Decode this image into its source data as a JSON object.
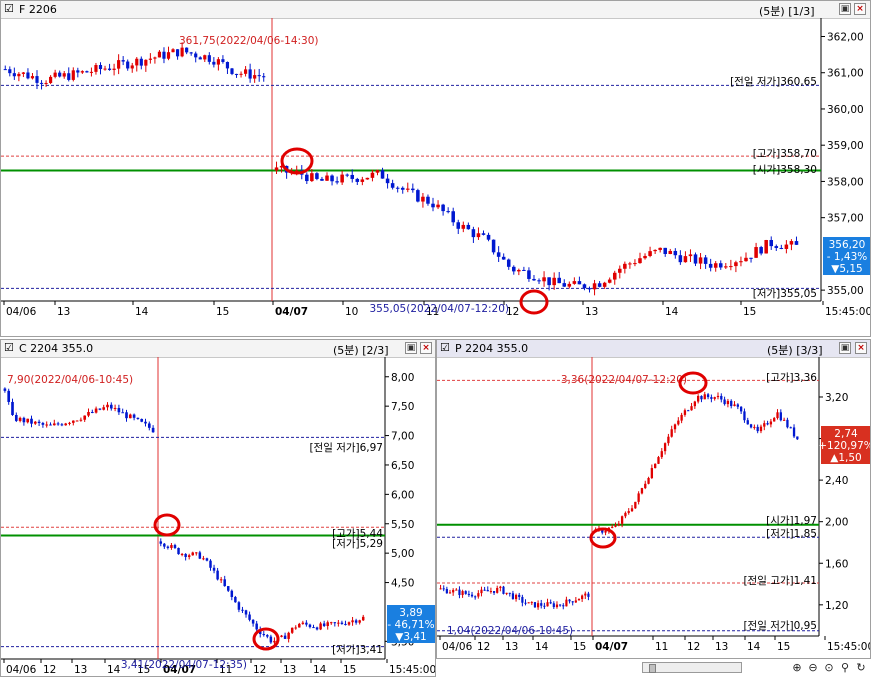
{
  "panels": {
    "f": {
      "title": "F 2206",
      "period": "(5분) [1/3]",
      "btn_min": "▣",
      "btn_close": "×",
      "y_ticks": [
        "362,00",
        "361,00",
        "360,00",
        "359,00",
        "358,00",
        "357,00",
        "355,00"
      ],
      "x_ticks": [
        "04/06",
        "13",
        "14",
        "15",
        "04/07",
        "10",
        "11",
        "12",
        "13",
        "14",
        "15",
        "15:45:00"
      ],
      "annotations": {
        "high_marker": "361,75(2022/04/06-14:30)",
        "prev_low": "[전일 저가]360,65",
        "day_high": "[고가]358,70",
        "day_open": "[시가]358,30",
        "day_low": "[저가]355,05",
        "low_marker": "355,05(2022/04/07-12:20)"
      },
      "price_box": {
        "price": "356,20",
        "pct": "- 1,43%",
        "chg": "▼5,15"
      }
    },
    "c": {
      "title": "C 2204 355.0",
      "period": "(5분) [2/3]",
      "btn_min": "▣",
      "btn_close": "×",
      "y_ticks": [
        "8,00",
        "7,50",
        "7,00",
        "6,50",
        "6,00",
        "5,50",
        "5,00",
        "4,50",
        "3,50"
      ],
      "x_ticks": [
        "04/06",
        "12",
        "13",
        "14",
        "15",
        "04/07",
        "11",
        "12",
        "13",
        "14",
        "15",
        "15:45:00"
      ],
      "annotations": {
        "high_marker": "7,90(2022/04/06-10:45)",
        "prev_low": "[전일 저가]6,97",
        "day_high": "[고가]5,44",
        "day_low_top": "[저가]5,29",
        "day_low": "[저가]3,41",
        "low_marker": "3,41(2022/04/07-12:35)"
      },
      "price_box": {
        "price": "3,89",
        "pct": "- 46,71%",
        "chg": "▼3,41"
      }
    },
    "p": {
      "title": "P 2204 355.0",
      "period": "(5분) [3/3]",
      "btn_min": "▣",
      "btn_close": "×",
      "y_ticks": [
        "3,20",
        "2,80",
        "2,40",
        "2,00",
        "1,60",
        "1,20"
      ],
      "x_ticks": [
        "04/06",
        "12",
        "13",
        "14",
        "15",
        "04/07",
        "11",
        "12",
        "13",
        "14",
        "15",
        "15:45:00"
      ],
      "annotations": {
        "high_marker": "3,36(2022/04/07-12:20)",
        "day_high": "[고가]3,36",
        "day_open": "[시가]1,97",
        "day_low": "[저가]1,85",
        "prev_high": "[전일 고가]1,41",
        "low_marker": "1,04(2022/04/06-10:45)",
        "prev_low": "[전일 저가]0,95"
      },
      "price_box": {
        "price": "2,74",
        "pct": "+120,97%",
        "chg": "▲1,50"
      }
    }
  },
  "colors": {
    "up": "#e00000",
    "down": "#0018d0",
    "open_line": "#009000",
    "ref_red": "#e04040",
    "ref_blue": "#2020a0",
    "box_blue": "#1a7fe0",
    "box_red": "#d83020"
  },
  "chart_data": [
    {
      "type": "candlestick",
      "name": "F 2206",
      "ylim": [
        354.7,
        362.4
      ],
      "day1_close": 360.9,
      "day2_path": [
        [
          0,
          358.3
        ],
        [
          0.05,
          358.2
        ],
        [
          0.08,
          358.0
        ],
        [
          0.15,
          358.1
        ],
        [
          0.2,
          358.2
        ],
        [
          0.25,
          357.7
        ],
        [
          0.3,
          357.4
        ],
        [
          0.35,
          356.8
        ],
        [
          0.4,
          356.4
        ],
        [
          0.45,
          355.6
        ],
        [
          0.5,
          355.4
        ],
        [
          0.53,
          355.2
        ],
        [
          0.58,
          355.1
        ],
        [
          0.62,
          355.2
        ],
        [
          0.66,
          355.6
        ],
        [
          0.7,
          355.9
        ],
        [
          0.74,
          356.1
        ],
        [
          0.78,
          355.9
        ],
        [
          0.84,
          355.7
        ],
        [
          0.9,
          355.9
        ],
        [
          0.95,
          356.3
        ],
        [
          1.0,
          356.2
        ]
      ],
      "day1_path": [
        [
          0,
          361.1
        ],
        [
          0.15,
          360.8
        ],
        [
          0.3,
          361.0
        ],
        [
          0.5,
          361.3
        ],
        [
          0.68,
          361.6
        ],
        [
          0.8,
          361.4
        ],
        [
          0.9,
          361.0
        ],
        [
          1.0,
          360.9
        ]
      ],
      "ref_lines": {
        "prev_low": 360.65,
        "day_high": 358.7,
        "day_open": 358.3,
        "day_low": 355.05
      }
    },
    {
      "type": "candlestick",
      "name": "C 2204 355.0",
      "ylim": [
        3.2,
        8.2
      ],
      "day1_path": [
        [
          0,
          7.8
        ],
        [
          0.05,
          7.3
        ],
        [
          0.3,
          7.15
        ],
        [
          0.5,
          7.3
        ],
        [
          0.7,
          7.5
        ],
        [
          0.85,
          7.3
        ],
        [
          1.0,
          7.1
        ]
      ],
      "day2_path": [
        [
          0,
          5.2
        ],
        [
          0.1,
          5.0
        ],
        [
          0.2,
          4.95
        ],
        [
          0.28,
          4.6
        ],
        [
          0.38,
          4.1
        ],
        [
          0.48,
          3.7
        ],
        [
          0.55,
          3.5
        ],
        [
          0.6,
          3.55
        ],
        [
          0.68,
          3.8
        ],
        [
          0.78,
          3.75
        ],
        [
          0.88,
          3.8
        ],
        [
          1.0,
          3.9
        ]
      ],
      "ref_lines": {
        "prev_low": 6.97,
        "day_high": 5.44,
        "day_open": 5.3,
        "day_low": 3.41
      }
    },
    {
      "type": "candlestick",
      "name": "P 2204 355.0",
      "ylim": [
        0.9,
        3.45
      ],
      "day1_path": [
        [
          0,
          1.35
        ],
        [
          0.2,
          1.3
        ],
        [
          0.4,
          1.35
        ],
        [
          0.6,
          1.2
        ],
        [
          0.8,
          1.2
        ],
        [
          1.0,
          1.3
        ]
      ],
      "day2_path": [
        [
          0,
          1.9
        ],
        [
          0.1,
          1.95
        ],
        [
          0.2,
          2.2
        ],
        [
          0.3,
          2.6
        ],
        [
          0.4,
          2.95
        ],
        [
          0.5,
          3.2
        ],
        [
          0.6,
          3.2
        ],
        [
          0.7,
          3.1
        ],
        [
          0.8,
          2.85
        ],
        [
          0.9,
          3.05
        ],
        [
          1.0,
          2.8
        ]
      ],
      "ref_lines": {
        "day_high": 3.36,
        "day_open": 1.97,
        "day_low": 1.85,
        "prev_high": 1.41,
        "prev_low": 0.95
      }
    }
  ],
  "toolbar": {
    "zoom_in": "⊕",
    "zoom_out": "⊖",
    "fit": "⊙",
    "search": "⚲",
    "refresh": "↻"
  }
}
